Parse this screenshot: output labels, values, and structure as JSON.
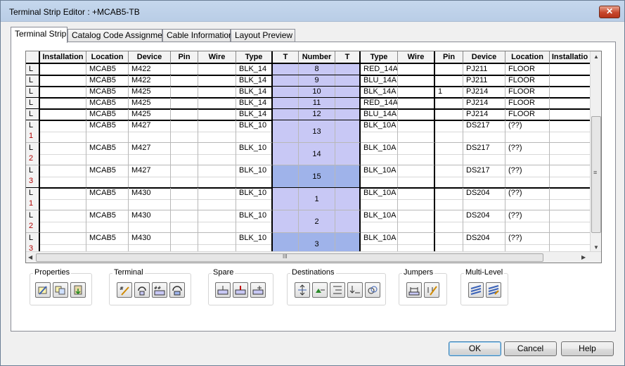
{
  "window": {
    "title": "Terminal Strip Editor : +MCAB5-TB",
    "close_glyph": "✕"
  },
  "tabs": [
    {
      "label": "Terminal Strip"
    },
    {
      "label": "Catalog Code Assignment"
    },
    {
      "label": "Cable Information"
    },
    {
      "label": "Layout Preview"
    }
  ],
  "grid": {
    "headers": [
      "",
      "Installation",
      "Location",
      "Device",
      "Pin",
      "Wire",
      "Type",
      "T",
      "Number",
      "T",
      "Type",
      "Wire",
      "Pin",
      "Device",
      "Location",
      "Installatio"
    ],
    "single_rows": [
      {
        "lvl": "L",
        "loc": "MCAB5",
        "dev": "M422",
        "pin": "",
        "wire": "",
        "type": "BLK_14",
        "num": "8",
        "rtype": "RED_14A",
        "rwire": "",
        "rpin": "",
        "rdev": "PJ211",
        "rloc": "FLOOR"
      },
      {
        "lvl": "L",
        "loc": "MCAB5",
        "dev": "M422",
        "pin": "",
        "wire": "",
        "type": "BLK_14",
        "num": "9",
        "rtype": "BLU_14A",
        "rwire": "",
        "rpin": "",
        "rdev": "PJ211",
        "rloc": "FLOOR"
      },
      {
        "lvl": "L",
        "loc": "MCAB5",
        "dev": "M425",
        "pin": "",
        "wire": "",
        "type": "BLK_14",
        "num": "10",
        "rtype": "BLK_14A",
        "rwire": "",
        "rpin": "1",
        "rdev": "PJ214",
        "rloc": "FLOOR"
      },
      {
        "lvl": "L",
        "loc": "MCAB5",
        "dev": "M425",
        "pin": "",
        "wire": "",
        "type": "BLK_14",
        "num": "11",
        "rtype": "RED_14A",
        "rwire": "",
        "rpin": "",
        "rdev": "PJ214",
        "rloc": "FLOOR"
      },
      {
        "lvl": "L",
        "loc": "MCAB5",
        "dev": "M425",
        "pin": "",
        "wire": "",
        "type": "BLK_14",
        "num": "12",
        "rtype": "BLU_14A",
        "rwire": "",
        "rpin": "",
        "rdev": "PJ214",
        "rloc": "FLOOR"
      }
    ],
    "multi_rows": [
      {
        "lvl": "L",
        "sub": "1",
        "loc": "MCAB5",
        "dev": "M427",
        "type": "BLK_10",
        "num": "13",
        "rtype": "BLK_10A",
        "rdev": "DS217",
        "rloc": "(??)"
      },
      {
        "lvl": "L",
        "sub": "2",
        "loc": "MCAB5",
        "dev": "M427",
        "type": "BLK_10",
        "num": "14",
        "rtype": "BLK_10A",
        "rdev": "DS217",
        "rloc": "(??)"
      },
      {
        "lvl": "L",
        "sub": "3",
        "loc": "MCAB5",
        "dev": "M427",
        "type": "BLK_10",
        "num": "15",
        "rtype": "BLK_10A",
        "rdev": "DS217",
        "rloc": "(??)"
      },
      {
        "lvl": "L",
        "sub": "1",
        "loc": "MCAB5",
        "dev": "M430",
        "type": "BLK_10",
        "num": "1",
        "rtype": "BLK_10A",
        "rdev": "DS204",
        "rloc": "(??)"
      },
      {
        "lvl": "L",
        "sub": "2",
        "loc": "MCAB5",
        "dev": "M430",
        "type": "BLK_10",
        "num": "2",
        "rtype": "BLK_10A",
        "rdev": "DS204",
        "rloc": "(??)"
      },
      {
        "lvl": "L",
        "sub": "3",
        "loc": "MCAB5",
        "dev": "M430",
        "type": "BLK_10",
        "num": "3",
        "rtype": "BLK_10A",
        "rdev": "DS204",
        "rloc": "(??)"
      }
    ],
    "vscroll_middle_glyph": "≡",
    "hscroll_middle_glyph": "III"
  },
  "groups": {
    "properties": "Properties",
    "terminal": "Terminal",
    "spare": "Spare",
    "destinations": "Destinations",
    "jumpers": "Jumpers",
    "multilevel": "Multi-Level"
  },
  "buttons": {
    "ok": "OK",
    "cancel": "Cancel",
    "help": "Help"
  },
  "colors": {
    "terminal_fill": "#c8c8f5",
    "terminal_selected": "#9fb3ea",
    "level_red": "#b00000"
  }
}
